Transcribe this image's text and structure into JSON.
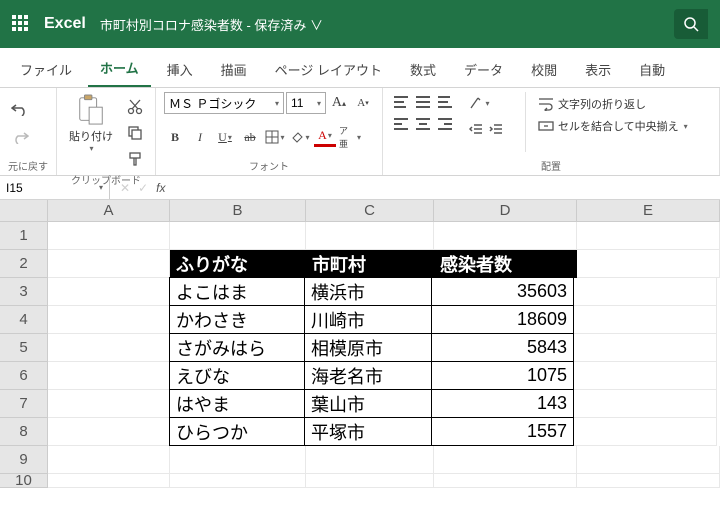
{
  "title": {
    "brand": "Excel",
    "document": "市町村別コロナ感染者数",
    "status": "- 保存済み ∨"
  },
  "tabs": [
    "ファイル",
    "ホーム",
    "挿入",
    "描画",
    "ページ レイアウト",
    "数式",
    "データ",
    "校閲",
    "表示",
    "自動"
  ],
  "active_tab": 1,
  "ribbon": {
    "undo_group": "元に戻す",
    "clipboard_group": "クリップボード",
    "paste_label": "貼り付け",
    "font_group": "フォント",
    "font_name": "ＭＳ Ｐゴシック",
    "font_size": "11",
    "align_group": "配置",
    "wrap_label": "文字列の折り返し",
    "merge_label": "セルを結合して中央揃え"
  },
  "namebox": "I15",
  "cols": [
    "A",
    "B",
    "C",
    "D",
    "E"
  ],
  "rows": [
    "1",
    "2",
    "3",
    "4",
    "5",
    "6",
    "7",
    "8",
    "9",
    "10"
  ],
  "table": {
    "header": [
      "ふりがな",
      "市町村",
      "感染者数"
    ],
    "data": [
      [
        "よこはま",
        "横浜市",
        "35603"
      ],
      [
        "かわさき",
        "川崎市",
        "18609"
      ],
      [
        "さがみはら",
        "相模原市",
        "5843"
      ],
      [
        "えびな",
        "海老名市",
        "1075"
      ],
      [
        "はやま",
        "葉山市",
        "143"
      ],
      [
        "ひらつか",
        "平塚市",
        "1557"
      ]
    ]
  },
  "chart_data": {
    "type": "table",
    "title": "市町村別コロナ感染者数",
    "columns": [
      "ふりがな",
      "市町村",
      "感染者数"
    ],
    "rows": [
      {
        "ふりがな": "よこはま",
        "市町村": "横浜市",
        "感染者数": 35603
      },
      {
        "ふりがな": "かわさき",
        "市町村": "川崎市",
        "感染者数": 18609
      },
      {
        "ふりがな": "さがみはら",
        "市町村": "相模原市",
        "感染者数": 5843
      },
      {
        "ふりがな": "えびな",
        "市町村": "海老名市",
        "感染者数": 1075
      },
      {
        "ふりがな": "はやま",
        "市町村": "葉山市",
        "感染者数": 143
      },
      {
        "ふりがな": "ひらつか",
        "市町村": "平塚市",
        "感染者数": 1557
      }
    ]
  }
}
